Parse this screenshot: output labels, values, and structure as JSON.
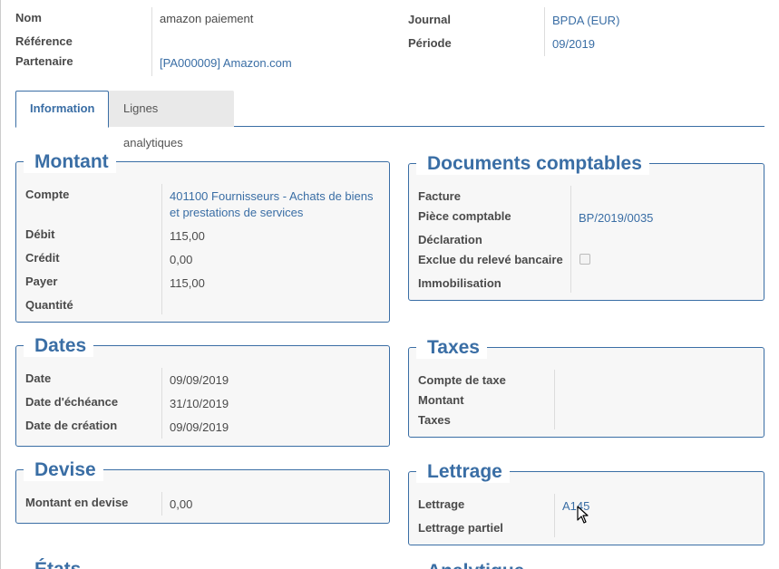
{
  "header": {
    "nom_label": "Nom",
    "nom_value": "amazon paiement",
    "reference_label": "Référence",
    "partenaire_label": "Partenaire",
    "partenaire_value": "[PA000009] Amazon.com",
    "journal_label": "Journal",
    "journal_value": "BPDA (EUR)",
    "periode_label": "Période",
    "periode_value": "09/2019"
  },
  "tabs": [
    {
      "label": "Information",
      "active": true
    },
    {
      "label": "Lignes analytiques",
      "active": false
    }
  ],
  "montant": {
    "title": "Montant",
    "compte_label": "Compte",
    "compte_value_line1": "401100 Fournisseurs - Achats de biens",
    "compte_value_line2": "et prestations de services",
    "debit_label": "Débit",
    "debit_value": "115,00",
    "credit_label": "Crédit",
    "credit_value": "0,00",
    "payer_label": "Payer",
    "payer_value": "115,00",
    "quantite_label": "Quantité"
  },
  "documents": {
    "title": "Documents comptables",
    "facture_label": "Facture",
    "piece_label": "Pièce comptable",
    "piece_value": "BP/2019/0035",
    "declaration_label": "Déclaration",
    "exclue_label": "Exclue du relevé bancaire",
    "immobilisation_label": "Immobilisation"
  },
  "dates": {
    "title": "Dates",
    "date_label": "Date",
    "date_value": "09/09/2019",
    "echeance_label": "Date d'échéance",
    "echeance_value": "31/10/2019",
    "creation_label": "Date de création",
    "creation_value": "09/09/2019"
  },
  "taxes": {
    "title": "Taxes",
    "compte_taxe_label": "Compte de taxe",
    "montant_label": "Montant",
    "taxes_label": "Taxes"
  },
  "devise": {
    "title": "Devise",
    "montant_devise_label": "Montant en devise",
    "montant_devise_value": "0,00"
  },
  "lettrage": {
    "title": "Lettrage",
    "lettrage_label": "Lettrage",
    "lettrage_value": "A145",
    "partiel_label": "Lettrage partiel"
  },
  "partial_titles": {
    "etats": "États",
    "analytique": "Analytique"
  },
  "colors": {
    "accent": "#3a6ea5",
    "group_bg": "#f7f7f7"
  }
}
